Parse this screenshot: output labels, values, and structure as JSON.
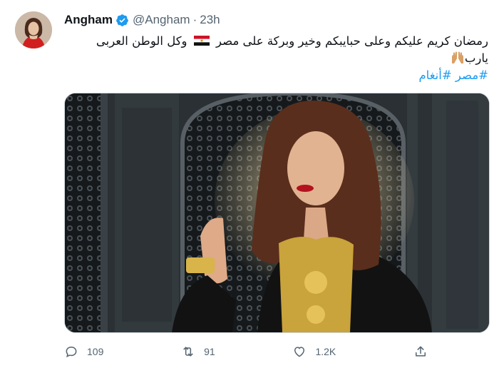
{
  "tweet": {
    "author": {
      "name": "Angham",
      "handle": "@Angham",
      "verified": true
    },
    "separator": "·",
    "time": "23h",
    "text_lines": [
      "رمضان كريم عليكم وعلى حبايبكم وخير وبركة على مصر",
      "وكل الوطن العربى",
      "يارب"
    ],
    "hashtags": [
      "#مصر",
      "#أنغام"
    ],
    "stats": {
      "replies": "109",
      "retweets": "91",
      "likes": "1.2K"
    }
  },
  "icons": {
    "verified": "verified-badge-icon",
    "flag": "egypt-flag-emoji",
    "hands": "raised-hands-emoji",
    "reply": "reply-icon",
    "retweet": "retweet-icon",
    "like": "heart-icon",
    "share": "share-icon"
  },
  "colors": {
    "link": "#1d9bf0",
    "verified": "#1d9bf0",
    "muted": "#536471"
  }
}
